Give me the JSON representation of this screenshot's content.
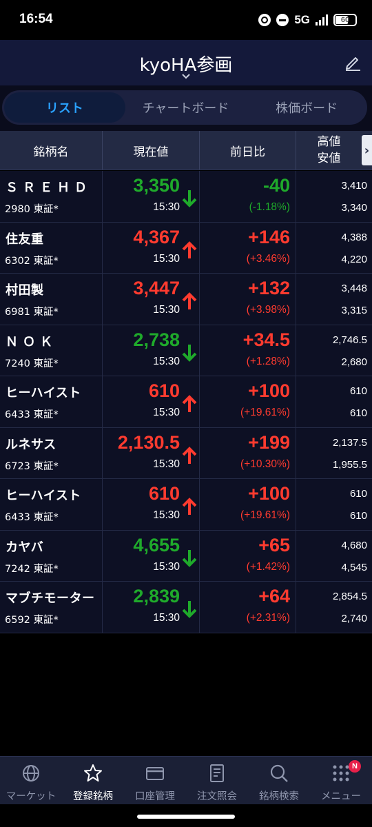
{
  "status_bar": {
    "time": "16:54",
    "network": "5G",
    "battery": "60",
    "icons": [
      "sync-icon",
      "dnd-icon",
      "signal-icon",
      "battery-icon"
    ]
  },
  "header": {
    "title": "kyoHA参画",
    "icons": [
      "chevron-down-icon",
      "edit-icon"
    ]
  },
  "tabs": [
    {
      "label": "リスト",
      "active": true
    },
    {
      "label": "チャートボード",
      "active": false
    },
    {
      "label": "株価ボード",
      "active": false
    }
  ],
  "table": {
    "headers": {
      "name": "銘柄名",
      "price": "現在値",
      "change": "前日比",
      "high": "高値",
      "low": "安値",
      "more": "›"
    },
    "rows": [
      {
        "name": "ＳＲＥＨＤ",
        "code": "2980 東証*",
        "price": "3,350",
        "time": "15:30",
        "direction": "down",
        "change": "-40",
        "change_pct": "(-1.18%)",
        "high": "3,410",
        "low": "3,340"
      },
      {
        "name": "住友重",
        "code": "6302 東証*",
        "price": "4,367",
        "time": "15:30",
        "direction": "up",
        "change": "+146",
        "change_pct": "(+3.46%)",
        "high": "4,388",
        "low": "4,220"
      },
      {
        "name": "村田製",
        "code": "6981 東証*",
        "price": "3,447",
        "time": "15:30",
        "direction": "up",
        "change": "+132",
        "change_pct": "(+3.98%)",
        "high": "3,448",
        "low": "3,315"
      },
      {
        "name": "ＮＯＫ",
        "code": "7240 東証*",
        "price": "2,738",
        "time": "15:30",
        "direction": "down",
        "change": "+34.5",
        "change_pct": "(+1.28%)",
        "high": "2,746.5",
        "low": "2,680"
      },
      {
        "name": "ヒーハイスト",
        "code": "6433 東証*",
        "price": "610",
        "time": "15:30",
        "direction": "up",
        "change": "+100",
        "change_pct": "(+19.61%)",
        "high": "610",
        "low": "610"
      },
      {
        "name": "ルネサス",
        "code": "6723 東証*",
        "price": "2,130.5",
        "time": "15:30",
        "direction": "up",
        "change": "+199",
        "change_pct": "(+10.30%)",
        "high": "2,137.5",
        "low": "1,955.5"
      },
      {
        "name": "ヒーハイスト",
        "code": "6433 東証*",
        "price": "610",
        "time": "15:30",
        "direction": "up",
        "change": "+100",
        "change_pct": "(+19.61%)",
        "high": "610",
        "low": "610"
      },
      {
        "name": "カヤバ",
        "code": "7242 東証*",
        "price": "4,655",
        "time": "15:30",
        "direction": "down",
        "change": "+65",
        "change_pct": "(+1.42%)",
        "high": "4,680",
        "low": "4,545"
      },
      {
        "name": "マブチモーター",
        "code": "6592 東証*",
        "price": "2,839",
        "time": "15:30",
        "direction": "down",
        "change": "+64",
        "change_pct": "(+2.31%)",
        "high": "2,854.5",
        "low": "2,740"
      }
    ]
  },
  "colors": {
    "up": "#ff3b2f",
    "down": "#1faa2b",
    "accent": "#2aa2ff",
    "header_bg": "#14193a",
    "badge": "#e8204a"
  },
  "bottom_nav": [
    {
      "label": "マーケット",
      "icon": "globe-icon",
      "active": false
    },
    {
      "label": "登録銘柄",
      "icon": "star-icon",
      "active": true
    },
    {
      "label": "口座管理",
      "icon": "card-icon",
      "active": false
    },
    {
      "label": "注文照会",
      "icon": "document-icon",
      "active": false
    },
    {
      "label": "銘柄検索",
      "icon": "search-icon",
      "active": false
    },
    {
      "label": "メニュー",
      "icon": "grid-icon",
      "active": false,
      "badge": "N"
    }
  ]
}
